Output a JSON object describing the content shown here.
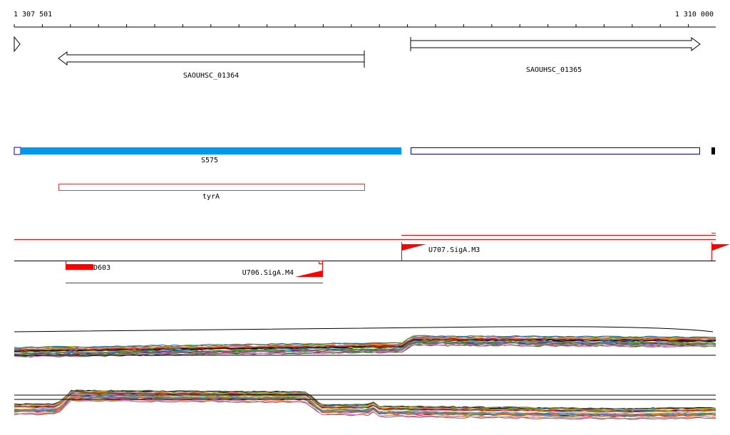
{
  "ruler": {
    "start_label": "1 307 501",
    "end_label": "1 310 000"
  },
  "genes": [
    {
      "id": "gene-saouhsc-01364",
      "label": "SAOUHSC_01364",
      "strand": "-"
    },
    {
      "id": "gene-saouhsc-01365",
      "label": "SAOUHSC_01365",
      "strand": "+"
    }
  ],
  "segments": [
    {
      "id": "segment-s575",
      "label": "S575",
      "color": "#0099ee"
    },
    {
      "id": "segment-tyra",
      "label": "tyrA",
      "color": "#e04040"
    }
  ],
  "transcripts": [
    {
      "id": "transcript-u707",
      "label": "U707.SigA.M3",
      "color": "#ff0000"
    },
    {
      "id": "transcript-d603",
      "label": "D603",
      "color": "#ff0000"
    },
    {
      "id": "transcript-u706",
      "label": "U706.SigA.M4",
      "color": "#ff0000"
    }
  ],
  "colors": {
    "axis": "#000000",
    "gene_outline": "#000000",
    "s575_fill": "#0099ee",
    "outline_blue": "#0000aa",
    "outline_red": "#e04040",
    "transcript_red": "#ff0000"
  }
}
